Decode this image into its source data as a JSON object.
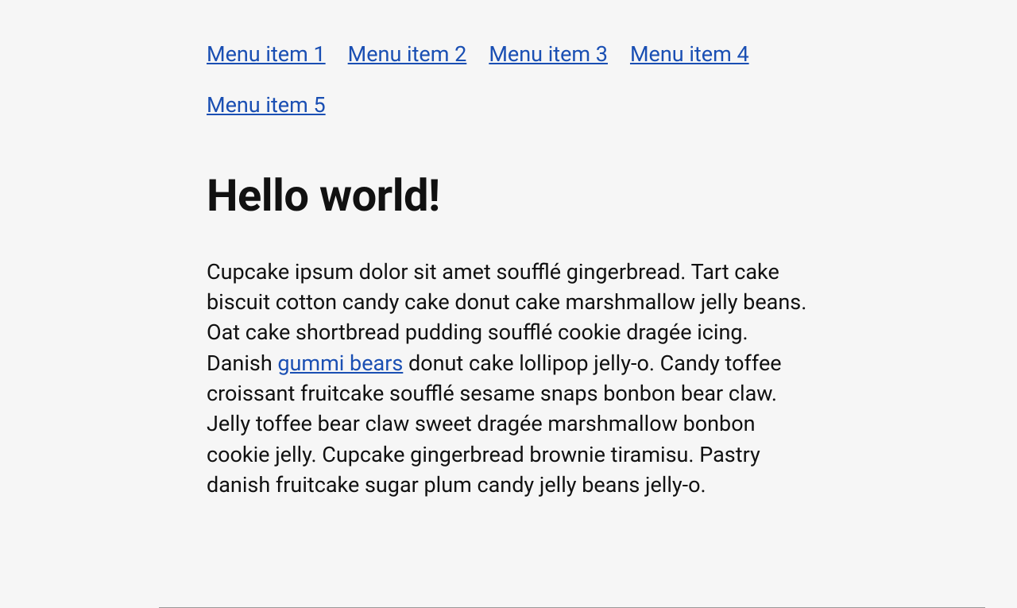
{
  "menu": {
    "items": [
      {
        "label": "Menu item 1"
      },
      {
        "label": "Menu item 2"
      },
      {
        "label": "Menu item 3"
      },
      {
        "label": "Menu item 4"
      },
      {
        "label": "Menu item 5"
      }
    ]
  },
  "heading": "Hello world!",
  "paragraph": {
    "part1": "Cupcake ipsum dolor sit amet soufflé gingerbread. Tart cake biscuit cotton candy cake donut cake marshmallow jelly beans. Oat cake shortbread pudding soufflé cookie dragée icing. Danish ",
    "link_text": "gummi bears",
    "part2": " donut cake lollipop jelly-o. Candy toffee croissant fruitcake soufflé sesame snaps bonbon bear claw. Jelly toffee bear claw sweet dragée marshmallow bonbon cookie jelly. Cupcake gingerbread brownie tiramisu. Pastry danish fruitcake sugar plum candy jelly beans jelly-o."
  }
}
